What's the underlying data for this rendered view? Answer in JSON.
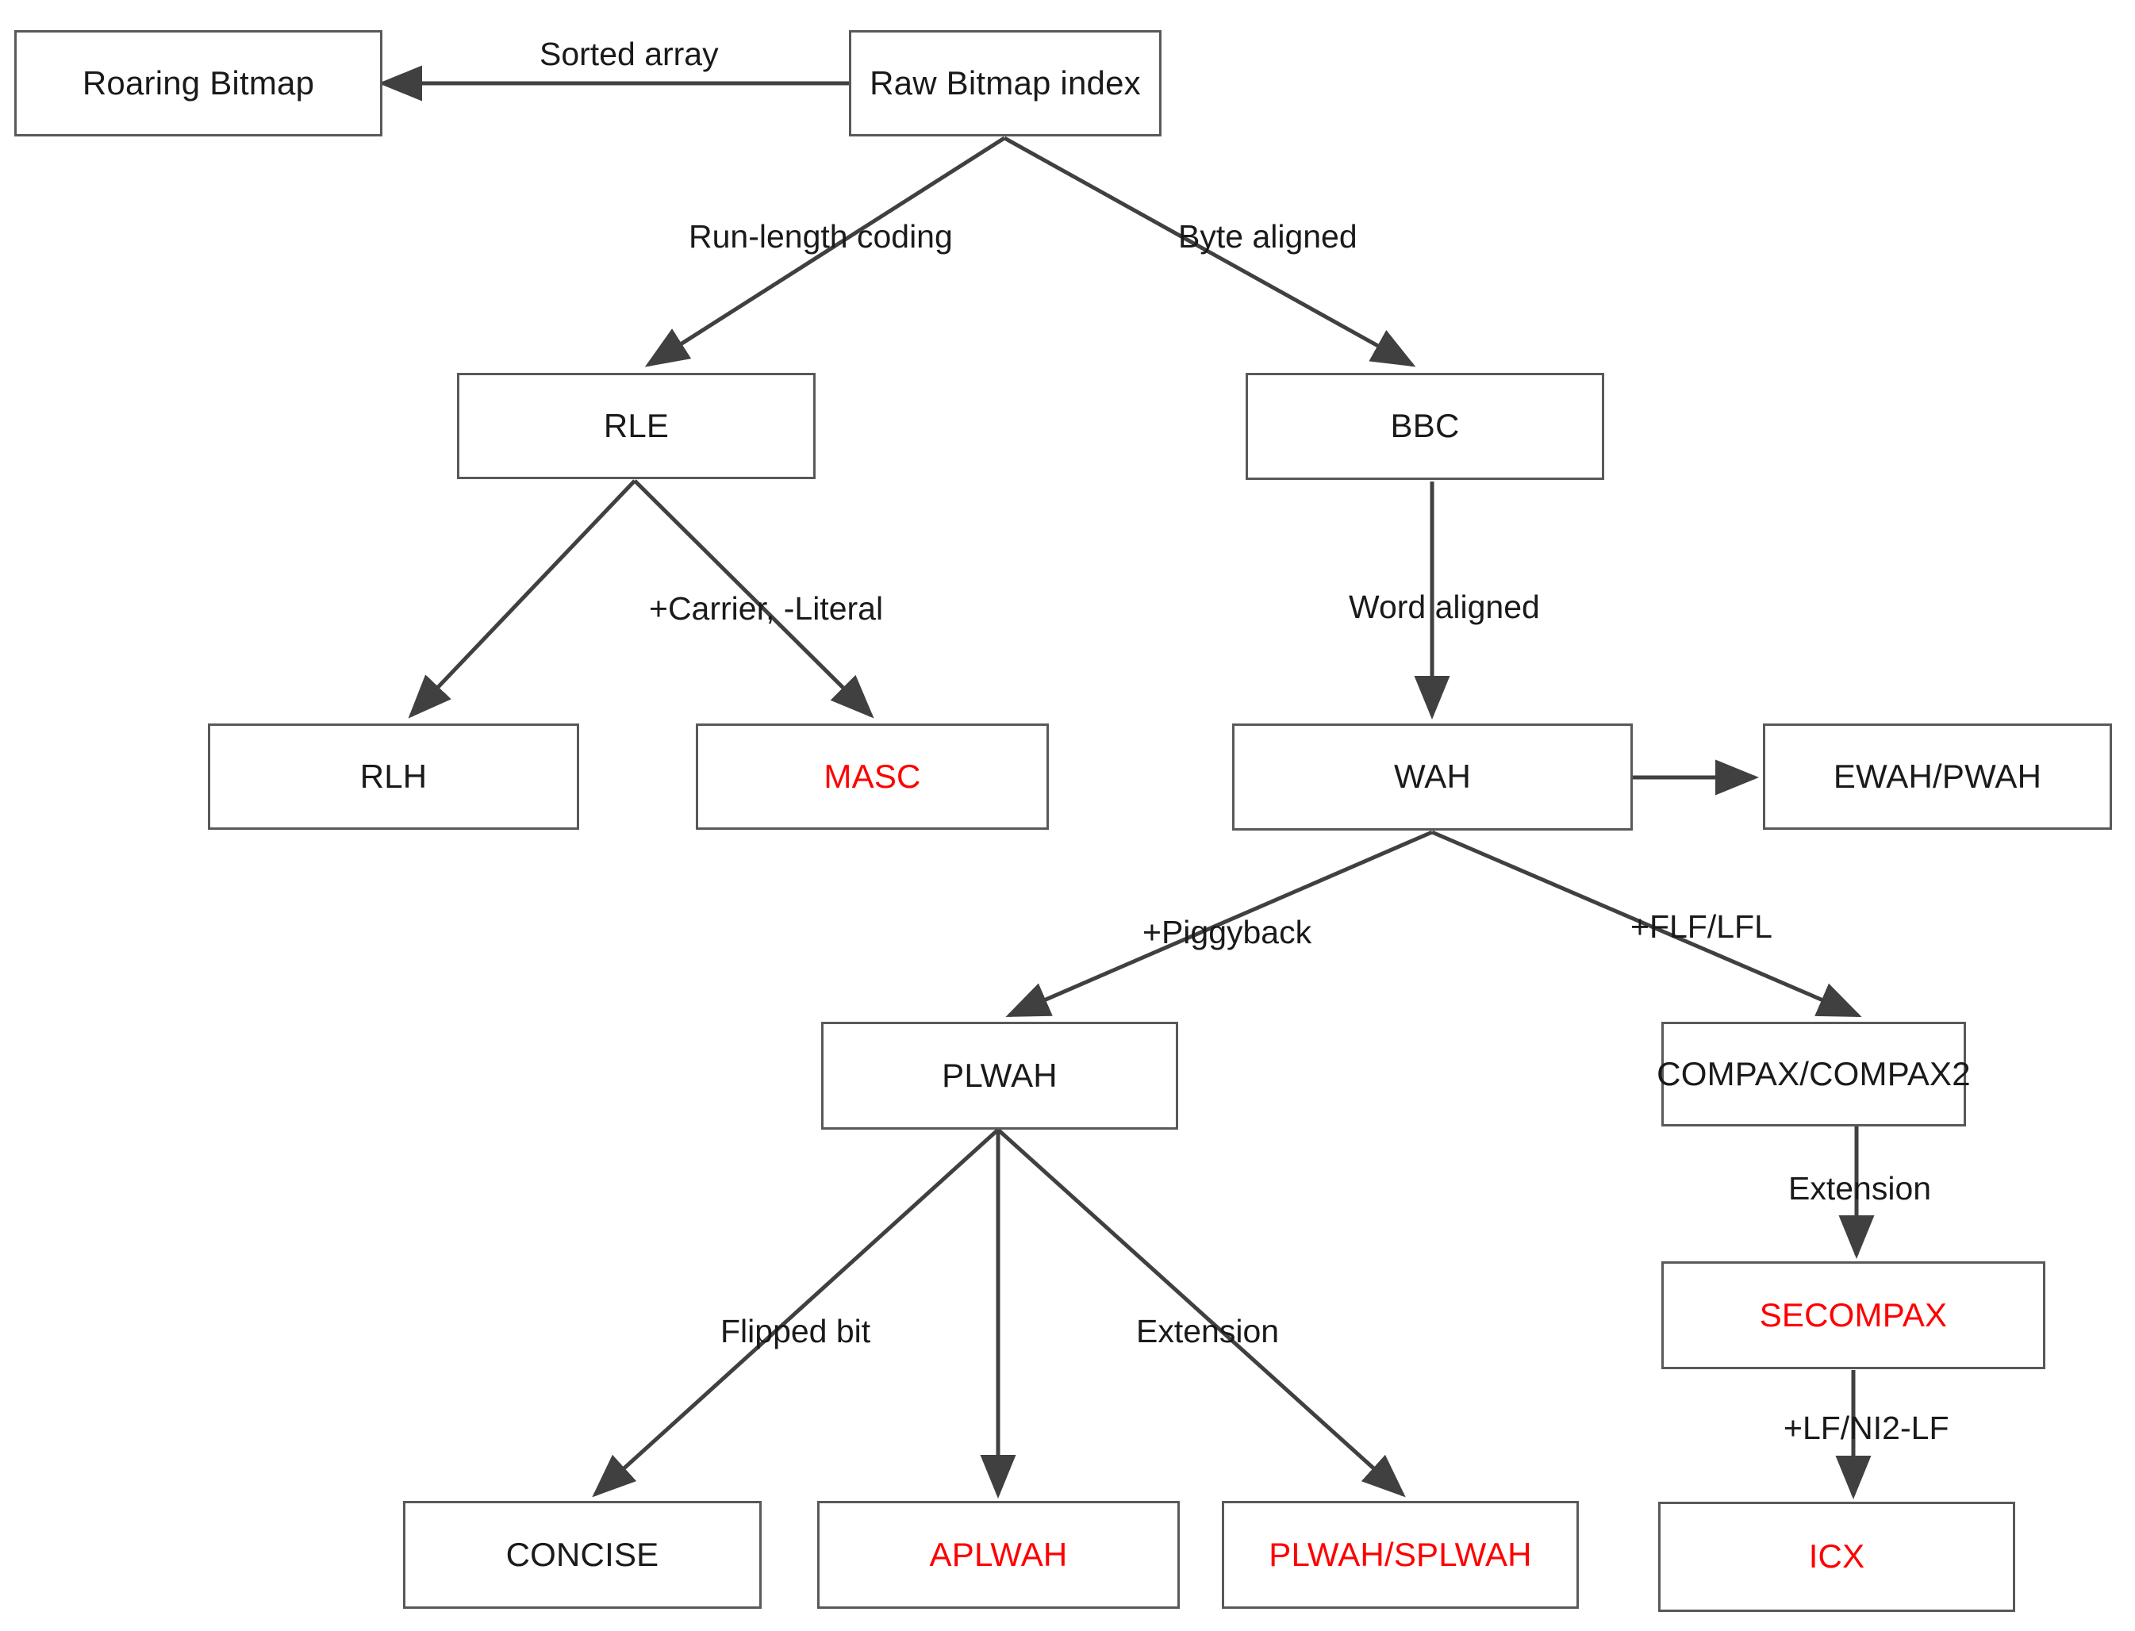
{
  "diagram": {
    "type": "flowchart",
    "title": "Bitmap index compression technique taxonomy",
    "colors": {
      "box_border": "#595959",
      "box_fill": "#ffffff",
      "text_default": "#1a1a1a",
      "text_highlight": "#ff0000",
      "edge": "#404040",
      "background": "#ffffff"
    },
    "nodes": [
      {
        "id": "roaring_bitmap",
        "label": "Roaring Bitmap",
        "highlight": false
      },
      {
        "id": "raw_bitmap_index",
        "label": "Raw Bitmap index",
        "highlight": false
      },
      {
        "id": "rle",
        "label": "RLE",
        "highlight": false
      },
      {
        "id": "bbc",
        "label": "BBC",
        "highlight": false
      },
      {
        "id": "rlh",
        "label": "RLH",
        "highlight": false
      },
      {
        "id": "masc",
        "label": "MASC",
        "highlight": true
      },
      {
        "id": "wah",
        "label": "WAH",
        "highlight": false
      },
      {
        "id": "ewah_pwah",
        "label": "EWAH/PWAH",
        "highlight": false
      },
      {
        "id": "plwah",
        "label": "PLWAH",
        "highlight": false
      },
      {
        "id": "compax",
        "label": "COMPAX/COMPAX2",
        "highlight": false
      },
      {
        "id": "secompax",
        "label": "SECOMPAX",
        "highlight": true
      },
      {
        "id": "concise",
        "label": "CONCISE",
        "highlight": false
      },
      {
        "id": "aplwah",
        "label": "APLWAH",
        "highlight": true
      },
      {
        "id": "plwah_splwah",
        "label": "PLWAH/SPLWAH",
        "highlight": true
      },
      {
        "id": "icx",
        "label": "ICX",
        "highlight": true
      }
    ],
    "edges": [
      {
        "id": "e1",
        "from": "raw_bitmap_index",
        "to": "roaring_bitmap",
        "label": "Sorted array"
      },
      {
        "id": "e2",
        "from": "raw_bitmap_index",
        "to": "rle",
        "label": "Run-length coding"
      },
      {
        "id": "e3",
        "from": "raw_bitmap_index",
        "to": "bbc",
        "label": "Byte aligned"
      },
      {
        "id": "e4",
        "from": "rle",
        "to": "rlh",
        "label": ""
      },
      {
        "id": "e5",
        "from": "rle",
        "to": "masc",
        "label": "+Carrier, -Literal"
      },
      {
        "id": "e6",
        "from": "bbc",
        "to": "wah",
        "label": "Word aligned"
      },
      {
        "id": "e7",
        "from": "wah",
        "to": "ewah_pwah",
        "label": ""
      },
      {
        "id": "e8",
        "from": "wah",
        "to": "plwah",
        "label": "+Piggyback"
      },
      {
        "id": "e9",
        "from": "wah",
        "to": "compax",
        "label": "+FLF/LFL"
      },
      {
        "id": "e10",
        "from": "compax",
        "to": "secompax",
        "label": "Extension"
      },
      {
        "id": "e11",
        "from": "secompax",
        "to": "icx",
        "label": "+LF/NI2-LF"
      },
      {
        "id": "e12",
        "from": "plwah",
        "to": "concise",
        "label": "Flipped bit"
      },
      {
        "id": "e13",
        "from": "plwah",
        "to": "aplwah",
        "label": ""
      },
      {
        "id": "e14",
        "from": "plwah",
        "to": "plwah_splwah",
        "label": "Extension"
      }
    ],
    "edge_labels": {
      "sorted_array": "Sorted array",
      "run_length_coding": "Run-length coding",
      "byte_aligned": "Byte aligned",
      "carrier_literal": "+Carrier, -Literal",
      "word_aligned": "Word aligned",
      "piggyback": "+Piggyback",
      "flf_lfl": "+FLF/LFL",
      "extension_compax": "Extension",
      "lf_ni2_lf": "+LF/NI2-LF",
      "flipped_bit": "Flipped bit",
      "extension_plwah": "Extension"
    }
  }
}
